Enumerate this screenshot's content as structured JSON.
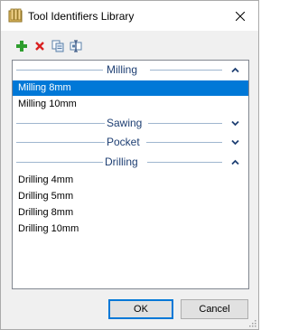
{
  "window": {
    "title": "Tool Identifiers Library",
    "icon": "library-icon"
  },
  "toolbar": {
    "add_icon": "add-icon",
    "delete_icon": "delete-icon",
    "copy_icon": "copy-icon",
    "rename_icon": "rename-icon"
  },
  "groups": [
    {
      "title": "Milling",
      "state": "expanded",
      "items": [
        {
          "label": "Milling 8mm",
          "selected": true
        },
        {
          "label": "Milling 10mm",
          "selected": false
        }
      ]
    },
    {
      "title": "Sawing",
      "state": "collapsed",
      "items": []
    },
    {
      "title": "Pocket",
      "state": "collapsed",
      "items": []
    },
    {
      "title": "Drilling",
      "state": "expanded",
      "items": [
        {
          "label": "Drilling 4mm",
          "selected": false
        },
        {
          "label": "Drilling 5mm",
          "selected": false
        },
        {
          "label": "Drilling 8mm",
          "selected": false
        },
        {
          "label": "Drilling 10mm",
          "selected": false
        }
      ]
    }
  ],
  "buttons": {
    "ok_label": "OK",
    "cancel_label": "Cancel"
  },
  "colors": {
    "selection": "#0078d7",
    "group_title": "#1e3f73",
    "add_green": "#2e9e2e",
    "delete_red": "#d92020"
  }
}
